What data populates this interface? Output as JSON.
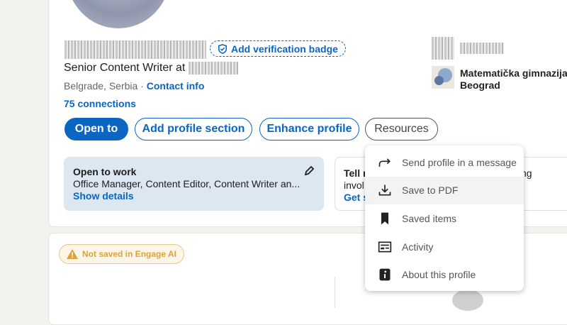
{
  "profile": {
    "verification_label": "Add verification badge",
    "headline": "Senior Content Writer at",
    "location": "Belgrade, Serbia ·",
    "contact_info": "Contact info",
    "connections": "75 connections"
  },
  "education": {
    "school_line1": "Matematička gimnazija",
    "school_line2": "Beograd"
  },
  "actions": {
    "open_to": "Open to",
    "add_section": "Add profile section",
    "enhance": "Enhance profile",
    "resources": "Resources"
  },
  "open_to_work": {
    "title": "Open to work",
    "roles": "Office Manager, Content Editor, Content Writer an...",
    "show_details": "Show details"
  },
  "tell_card": {
    "line1": "Tell m",
    "line1_tail": "ng",
    "line2": "invol",
    "link": "Get s"
  },
  "menu": {
    "items": [
      {
        "label": "Send profile in a message",
        "icon": "share-arrow-icon"
      },
      {
        "label": "Save to PDF",
        "icon": "download-icon"
      },
      {
        "label": "Saved items",
        "icon": "bookmark-icon"
      },
      {
        "label": "Activity",
        "icon": "activity-icon"
      },
      {
        "label": "About this profile",
        "icon": "info-icon"
      }
    ]
  },
  "engage": {
    "label": "Not saved in Engage AI"
  },
  "colors": {
    "brand": "#0a66c2",
    "warning": "#e0a03a"
  }
}
